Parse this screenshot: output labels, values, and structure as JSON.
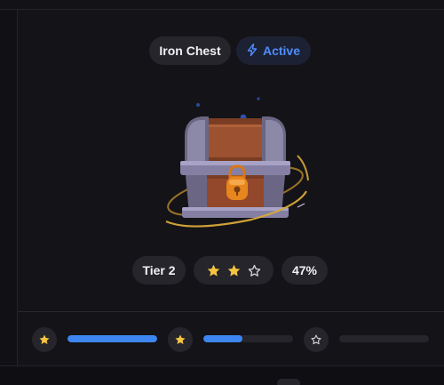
{
  "chest": {
    "name": "Iron Chest",
    "status": "Active",
    "tier": "Tier 2",
    "stars_filled": 2,
    "stars_total": 3,
    "progress_label": "47%"
  },
  "progress": {
    "segments": [
      {
        "icon": "star-filled-icon",
        "fill": 1.0
      },
      {
        "icon": "star-filled-icon",
        "fill": 0.44
      },
      {
        "icon": "star-outline-icon",
        "fill": 0.0
      }
    ]
  },
  "colors": {
    "accent": "#3d86f2",
    "status_text": "#4e8cff",
    "star": "#f5c542",
    "pill_bg": "#26252b",
    "background": "#141318"
  }
}
